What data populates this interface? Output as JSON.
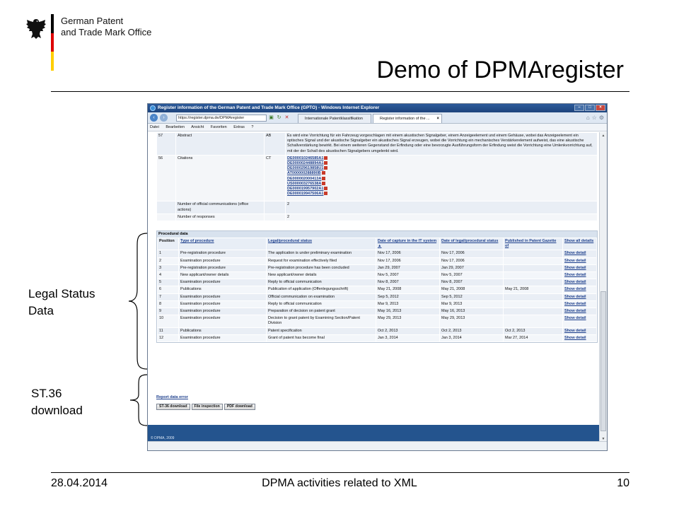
{
  "slide": {
    "org_line1": "German Patent",
    "org_line2": "and Trade Mark Office",
    "title": "Demo of DPMAregister",
    "label_legal_line1": "Legal Status",
    "label_legal_line2": "Data",
    "label_st36_line1": "ST.36",
    "label_st36_line2": "download",
    "footer_date": "28.04.2014",
    "footer_center": "DPMA activities related to XML",
    "footer_page": "10",
    "flag_colors": [
      "#000000",
      "#dd0000",
      "#ffce00"
    ]
  },
  "browser": {
    "window_title": "Register information of the German Patent and Trade Mark Office (GPTO) - Windows Internet Explorer",
    "address": "https://register.dpma.de/DPMAregister",
    "tab1": "Internationale Patentklassifikation",
    "tab2": "Register information of the ...",
    "menu": [
      "Datei",
      "Bearbeiten",
      "Ansicht",
      "Favoriten",
      "Extras",
      "?"
    ]
  },
  "bibliographic": {
    "rows": [
      {
        "code": "57",
        "name": "Abstract",
        "short": "AB",
        "value": "Es wird eine Vorrichtung für ein Fahrzeug vorgeschlagen mit einem akustischen Signalgeber, einem Anzeigeelement und einem Gehäuse, wobei das Anzeigeelement ein optisches Signal und der akustische Signalgeber ein akustisches Signal erzeugen, wobei die Vorrichtung ein mechanisches Verstärkerelement aufweist, das eine akustische Schallverstärkung bewirkt. Bei einem weiteren Gegenstand der Erfindung oder eine bevorzugte Ausführungsform der Erfindung weist die Vorrichtung eine Umlenkvorrichtung auf, mit der der Schall des akustischen Signalgebers umgelenkt wird."
      },
      {
        "code": "56",
        "name": "Citations",
        "short": "CT",
        "citations": [
          "DE000010246585A1",
          "DE000002448894A1",
          "DE000029619858U1",
          "AT000000288890B",
          "DE000002000413A",
          "US000003276538A",
          "DE000019957902A1",
          "DE000019947506A1"
        ]
      },
      {
        "code": "",
        "name": "Number of official communications (office actions)",
        "short": "",
        "value": "2"
      },
      {
        "code": "",
        "name": "Number of responses",
        "short": "",
        "value": "2"
      }
    ]
  },
  "procedural": {
    "title": "Procedural data",
    "headers": [
      "Position",
      "Type of procedure",
      "Legal/procedural status",
      "Date of capture in the IT system ▲",
      "Date of legal/procedural status",
      "Published in Patent Gazette of",
      "Show all details"
    ],
    "rows": [
      [
        "1",
        "Pre-registration procedure",
        "The application is under preliminary examination",
        "Nov 17, 2006",
        "Nov 17, 2006",
        "",
        "Show detail"
      ],
      [
        "2",
        "Examination procedure",
        "Request for examination effectively filed",
        "Nov 17, 2006",
        "Nov 17, 2006",
        "",
        "Show detail"
      ],
      [
        "3",
        "Pre-registration procedure",
        "Pre-registration procedure has been concluded",
        "Jan 29, 2007",
        "Jan 29, 2007",
        "",
        "Show detail"
      ],
      [
        "4",
        "New applicant/owner details",
        "New applicant/owner details",
        "Nov 5, 2007",
        "Nov 5, 2007",
        "",
        "Show detail"
      ],
      [
        "5",
        "Examination procedure",
        "Reply to official communication",
        "Nov 8, 2007",
        "Nov 8, 2007",
        "",
        "Show detail"
      ],
      [
        "6",
        "Publications",
        "Publication of application (Offenlegungsschrift)",
        "May 21, 2008",
        "May 21, 2008",
        "May 21, 2008",
        "Show detail"
      ],
      [
        "7",
        "Examination procedure",
        "Official communication on examination",
        "Sep 5, 2012",
        "Sep 5, 2012",
        "",
        "Show detail"
      ],
      [
        "8",
        "Examination procedure",
        "Reply to official communication",
        "Mar 9, 2013",
        "Mar 9, 2013",
        "",
        "Show detail"
      ],
      [
        "9",
        "Examination procedure",
        "Preparation of decision on patent grant",
        "May 16, 2013",
        "May 16, 2013",
        "",
        "Show detail"
      ],
      [
        "10",
        "Examination procedure",
        "Decision to grant patent by Examining Section/Patent Division",
        "May 29, 2013",
        "May 29, 2013",
        "",
        "Show detail"
      ],
      [
        "11",
        "Publications",
        "Patent specification",
        "Oct 2, 2013",
        "Oct 2, 2013",
        "Oct 2, 2013",
        "Show detail"
      ],
      [
        "12",
        "Examination procedure",
        "Grant of patent has become final",
        "Jan 3, 2014",
        "Jan 3, 2014",
        "Mar 27, 2014",
        "Show detail"
      ]
    ]
  },
  "downloads": {
    "report_error": "Report data error",
    "buttons": [
      "ST-36 download",
      "File inspection",
      "PDF download"
    ]
  },
  "page_footer": {
    "copyright": "© DPMA, 2009",
    "color": "#24548e"
  }
}
